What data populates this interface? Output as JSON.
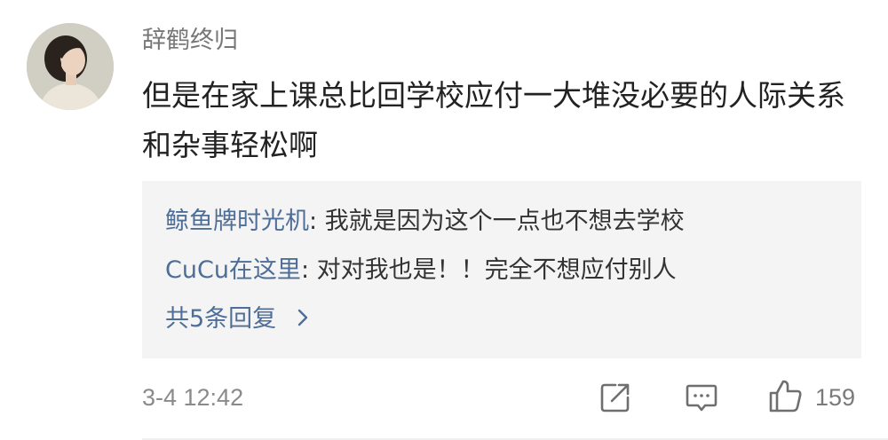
{
  "comment": {
    "username": "辞鹤终归",
    "content": "但是在家上课总比回学校应付一大堆没必要的人际关系和杂事轻松啊",
    "timestamp": "3-4 12:42",
    "like_count": "159"
  },
  "replies": {
    "items": [
      {
        "author": "鲸鱼牌时光机",
        "separator": ": ",
        "text": "我就是因为这个一点也不想去学校"
      },
      {
        "author": "CuCu在这里",
        "separator": ": ",
        "text": "对对我也是！！完全不想应付别人"
      }
    ],
    "more_label": "共5条回复"
  },
  "icons": {
    "share": "share-icon",
    "comment": "comment-icon",
    "like": "thumbs-up-icon",
    "chevron": "chevron-right-icon"
  },
  "colors": {
    "link": "#4e6e98",
    "reply_bg": "#f4f4f4",
    "secondary_text": "#8a8a8a"
  }
}
